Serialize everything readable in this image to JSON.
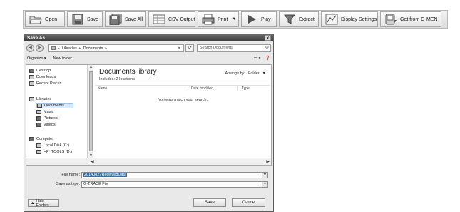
{
  "toolbar": {
    "buttons": [
      {
        "label": "Open",
        "icon": "folder-open-icon"
      },
      {
        "label": "Save",
        "icon": "save-icon"
      },
      {
        "label": "Save All",
        "icon": "save-all-icon"
      },
      {
        "label": "CSV Output",
        "icon": "csv-icon"
      },
      {
        "label": "Print",
        "icon": "printer-icon"
      },
      {
        "label": "Play",
        "icon": "play-icon"
      },
      {
        "label": "Extract",
        "icon": "funnel-icon"
      },
      {
        "label": "Display Settings",
        "icon": "display-settings-icon"
      },
      {
        "label": "Get from G-MEN",
        "icon": "download-device-icon"
      }
    ]
  },
  "dialog": {
    "title": "Save As",
    "close_glyph": "x",
    "address": {
      "part1": "Libraries",
      "part2": "Documents"
    },
    "search_placeholder": "Search Documents",
    "commands": {
      "organize": "Organize ▾",
      "new_folder": "New folder"
    },
    "nav": {
      "favorites": [
        "Desktop",
        "Downloads",
        "Recent Places"
      ],
      "libraries_header": "Libraries",
      "libraries": [
        "Documents",
        "Music",
        "Pictures",
        "Videos"
      ],
      "computer_header": "Computer",
      "drives": [
        "Local Disk (C:)",
        "HP_TOOLS (D:)"
      ]
    },
    "library": {
      "title": "Documents library",
      "includes": "Includes:  2 locations",
      "arrange_label": "Arrange by:",
      "arrange_value": "Folder"
    },
    "columns": [
      "Name",
      "Date modified",
      "Type"
    ],
    "empty_message": "No items match your search.",
    "file_name_label": "File name:",
    "file_name_value": "20140827ReceivedData",
    "save_type_label": "Save as type:",
    "save_type_value": "G-TRACE File",
    "hide_folders": "Hide Folders",
    "save_button": "Save",
    "cancel_button": "Cancel"
  }
}
